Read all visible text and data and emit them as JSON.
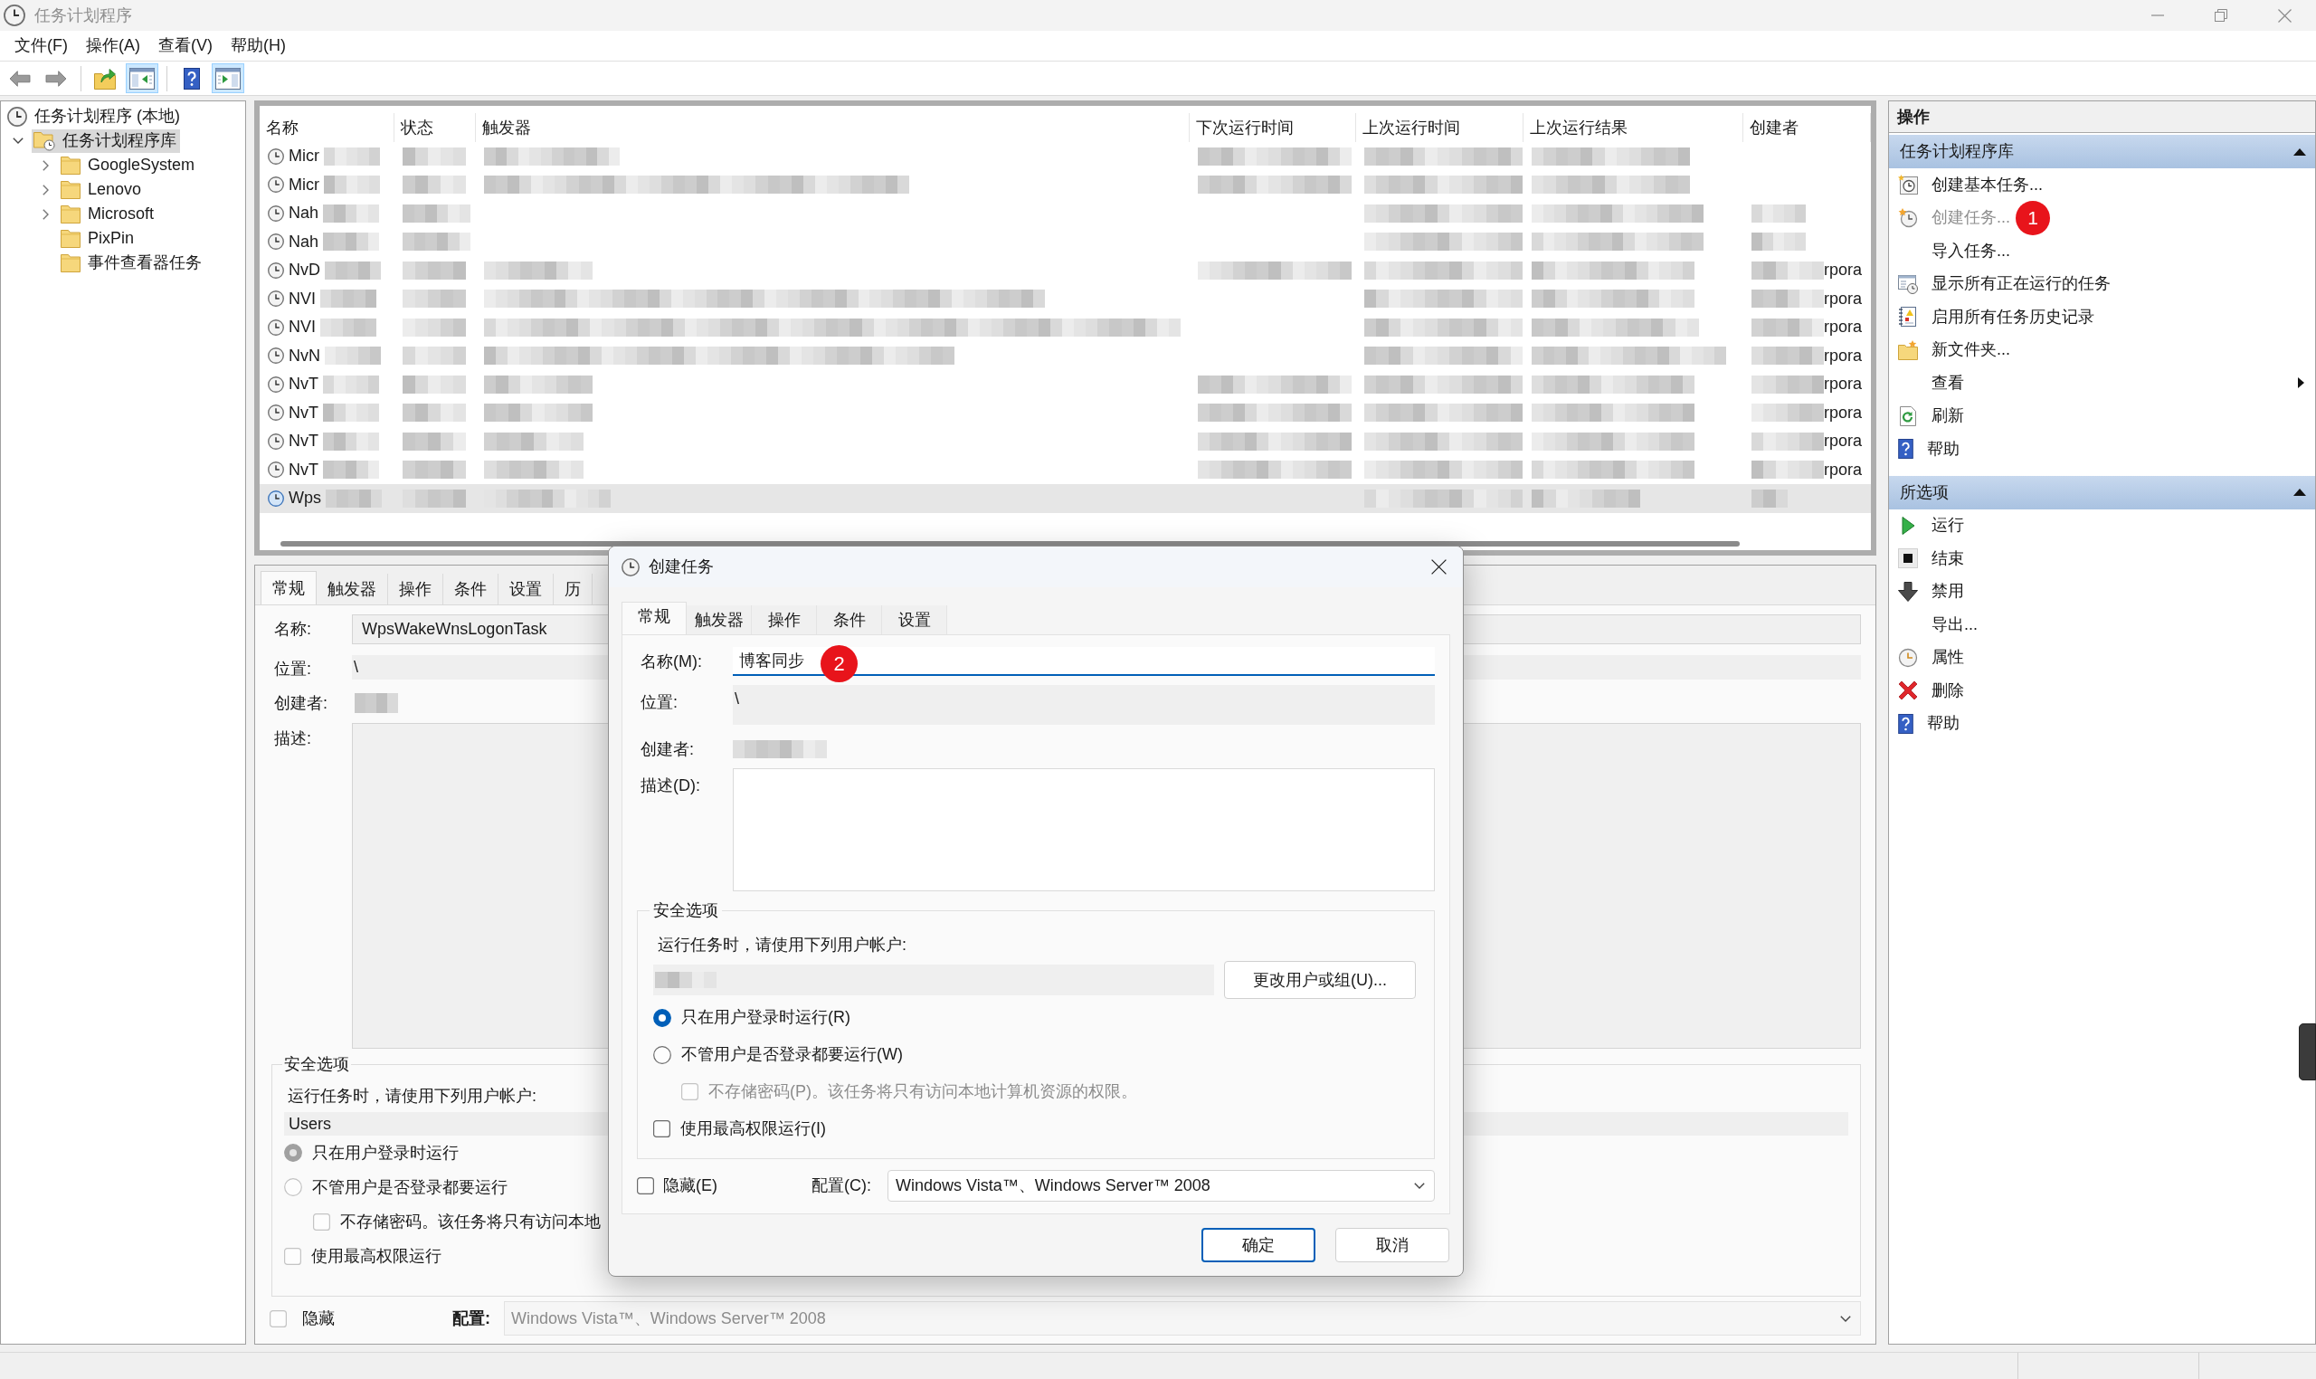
{
  "window": {
    "title": "任务计划程序"
  },
  "menu": [
    "文件(F)",
    "操作(A)",
    "查看(V)",
    "帮助(H)"
  ],
  "toolbar": [
    {
      "kind": "back",
      "pressed": false
    },
    {
      "kind": "forward",
      "pressed": false
    },
    {
      "kind": "up",
      "pressed": false
    },
    {
      "kind": "tree",
      "pressed": true
    },
    {
      "kind": "help",
      "pressed": false
    },
    {
      "kind": "pane",
      "pressed": true
    }
  ],
  "tree": {
    "root": "任务计划程序 (本地)",
    "items": [
      {
        "label": "任务计划程序库",
        "selected": true,
        "expanded": true,
        "children": [
          {
            "label": "GoogleSystem",
            "selected": false,
            "expanded": false
          },
          {
            "label": "Lenovo",
            "selected": false,
            "expanded": false
          },
          {
            "label": "Microsoft",
            "selected": false,
            "expanded": false
          },
          {
            "label": "PixPin",
            "selected": false
          },
          {
            "label": "事件查看器任务",
            "selected": false
          }
        ]
      }
    ]
  },
  "task_table": {
    "columns": [
      "名称",
      "状态",
      "触发器",
      "下次运行时间",
      "上次运行时间",
      "上次运行结果",
      "创建者"
    ],
    "rows": [
      {
        "name": "Micr",
        "selected": false
      },
      {
        "name": "Micr",
        "selected": false
      },
      {
        "name": "Nah",
        "selected": false
      },
      {
        "name": "Nah",
        "selected": false
      },
      {
        "name": "NvD",
        "creator": "rpora",
        "selected": false
      },
      {
        "name": "NVI",
        "creator": "rpora",
        "selected": false
      },
      {
        "name": "NVI",
        "creator": "rpora",
        "selected": false
      },
      {
        "name": "NvN",
        "creator": "rpora",
        "selected": false
      },
      {
        "name": "NvT",
        "creator": "rpora",
        "selected": false
      },
      {
        "name": "NvT",
        "creator": "rpora",
        "selected": false
      },
      {
        "name": "NvT",
        "creator": "rpora",
        "selected": false
      },
      {
        "name": "NvT",
        "creator": "rpora",
        "selected": false
      },
      {
        "name": "Wps",
        "selected": true
      }
    ]
  },
  "details": {
    "tabs": [
      {
        "label": "常规",
        "selected": true
      },
      {
        "label": "触发器",
        "selected": false
      },
      {
        "label": "操作",
        "selected": false
      },
      {
        "label": "条件",
        "selected": false
      },
      {
        "label": "设置",
        "selected": false
      },
      {
        "label": "历",
        "selected": false
      }
    ],
    "name": {
      "label": "名称:",
      "value": "WpsWakeWnsLogonTask"
    },
    "location": {
      "label": "位置:",
      "value": "\\"
    },
    "author": {
      "label": "创建者:"
    },
    "description": {
      "label": "描述:"
    },
    "security": {
      "title": "安全选项",
      "prompt": "运行任务时，请使用下列用户帐户:",
      "account": "Users",
      "options": [
        {
          "kind": "radio",
          "label": "只在用户登录时运行",
          "checked": true
        },
        {
          "kind": "radio",
          "label": "不管用户是否登录都要运行",
          "checked": false,
          "children": [
            {
              "kind": "checkbox",
              "label": "不存储密码。该任务将只有访问本地",
              "checked": false
            }
          ]
        },
        {
          "kind": "checkbox",
          "label": "使用最高权限运行",
          "checked": false
        }
      ]
    },
    "hidden": {
      "label": "隐藏",
      "checked": false
    },
    "config": {
      "label": "配置:",
      "value": "Windows Vista™、Windows Server™ 2008"
    }
  },
  "dialog": {
    "title": "创建任务",
    "tabs": [
      {
        "label": "常规",
        "selected": true
      },
      {
        "label": "触发器",
        "selected": false
      },
      {
        "label": "操作",
        "selected": false
      },
      {
        "label": "条件",
        "selected": false
      },
      {
        "label": "设置",
        "selected": false
      }
    ],
    "name": {
      "label": "名称(M):",
      "value": "博客同步",
      "marker": "2"
    },
    "location": {
      "label": "位置:",
      "value": "\\"
    },
    "author": {
      "label": "创建者:"
    },
    "description": {
      "label": "描述(D):"
    },
    "security": {
      "title": "安全选项",
      "prompt": "运行任务时，请使用下列用户帐户:",
      "change_button": "更改用户或组(U)...",
      "options": [
        {
          "kind": "radio",
          "label": "只在用户登录时运行(R)",
          "checked": true,
          "disabled": false
        },
        {
          "kind": "radio",
          "label": "不管用户是否登录都要运行(W)",
          "checked": false,
          "disabled": false,
          "children": [
            {
              "kind": "checkbox",
              "label": "不存储密码(P)。该任务将只有访问本地计算机资源的权限。",
              "checked": false,
              "disabled": true
            }
          ]
        },
        {
          "kind": "checkbox",
          "label": "使用最高权限运行(I)",
          "checked": false,
          "disabled": false
        }
      ]
    },
    "hidden": {
      "label": "隐藏(E)",
      "checked": false
    },
    "config": {
      "label": "配置(C):",
      "value": "Windows Vista™、Windows Server™ 2008"
    },
    "buttons": [
      {
        "label": "确定",
        "default": true
      },
      {
        "label": "取消",
        "default": false
      }
    ]
  },
  "actions": {
    "title": "操作",
    "sections": [
      {
        "title": "任务计划程序库",
        "expanded": true,
        "items": [
          {
            "kind": "basic",
            "label": "创建基本任务...",
            "disabled": false
          },
          {
            "kind": "create",
            "label": "创建任务...",
            "disabled": true,
            "marker": "1"
          },
          {
            "kind": "import",
            "label": "导入任务...",
            "disabled": false
          },
          {
            "kind": "running",
            "label": "显示所有正在运行的任务",
            "disabled": false
          },
          {
            "kind": "history",
            "label": "启用所有任务历史记录",
            "disabled": false
          },
          {
            "kind": "folder",
            "label": "新文件夹...",
            "disabled": false
          },
          {
            "kind": "view",
            "label": "查看",
            "disabled": false
          },
          {
            "kind": "refresh",
            "label": "刷新",
            "disabled": false
          },
          {
            "kind": "help",
            "label": "帮助",
            "disabled": false
          }
        ]
      },
      {
        "title": "所选项",
        "expanded": true,
        "items": [
          {
            "kind": "run",
            "label": "运行",
            "disabled": false
          },
          {
            "kind": "end",
            "label": "结束",
            "disabled": false
          },
          {
            "kind": "disable",
            "label": "禁用",
            "disabled": false
          },
          {
            "kind": "export",
            "label": "导出...",
            "disabled": false
          },
          {
            "kind": "properties",
            "label": "属性",
            "disabled": false
          },
          {
            "kind": "delete",
            "label": "删除",
            "disabled": false
          },
          {
            "kind": "help",
            "label": "帮助",
            "disabled": false
          }
        ]
      }
    ]
  }
}
